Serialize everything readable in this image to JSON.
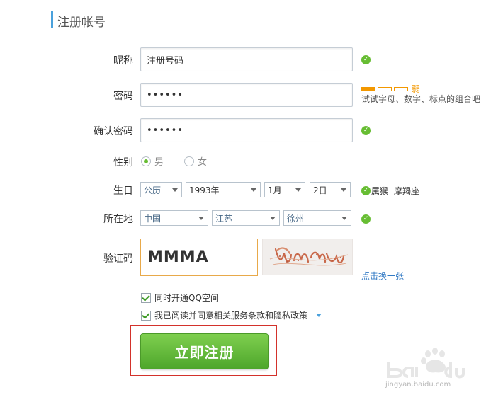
{
  "header": {
    "title": "注册帐号"
  },
  "form": {
    "nickname": {
      "label": "昵称",
      "value": "注册号码"
    },
    "password": {
      "label": "密码",
      "value": "••••••",
      "strength": "弱",
      "hint": "试试字母、数字、标点的组合吧"
    },
    "confirm": {
      "label": "确认密码",
      "value": "••••••"
    },
    "gender": {
      "label": "性别",
      "options": [
        "男",
        "女"
      ],
      "selected": "男"
    },
    "birthday": {
      "label": "生日",
      "calendar": "公历",
      "year": "1993年",
      "month": "1月",
      "day": "2日",
      "zodiac": "属猴",
      "constellation": "摩羯座"
    },
    "location": {
      "label": "所在地",
      "country": "中国",
      "province": "江苏",
      "city": "徐州"
    },
    "captcha": {
      "label": "验证码",
      "value": "MMMA",
      "refresh": "点击换一张"
    },
    "options": {
      "qzone": "同时开通QQ空间",
      "agree": "我已阅读并同意相关服务条款和隐私政策"
    },
    "submit": "立即注册"
  },
  "watermark": {
    "text": "jingyan.baidu.com"
  },
  "colors": {
    "accent": "#4aa1dc",
    "success": "#67bd33",
    "warning": "#f39800",
    "submit": "#5cb531",
    "highlight": "#d3322b"
  }
}
